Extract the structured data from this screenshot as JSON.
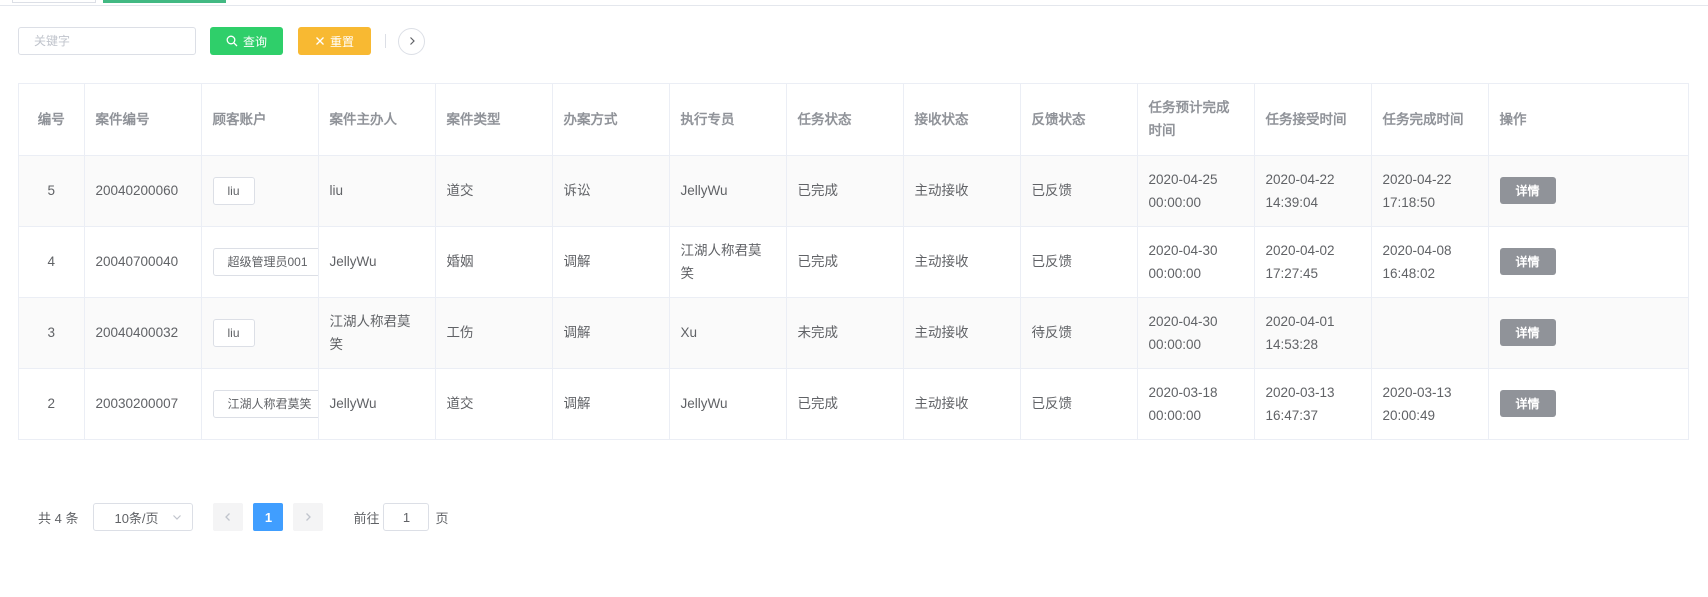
{
  "toolbar": {
    "search_placeholder": "关键字",
    "query_label": "查询",
    "reset_label": "重置"
  },
  "table": {
    "headers": [
      "编号",
      "案件编号",
      "顾客账户",
      "案件主办人",
      "案件类型",
      "办案方式",
      "执行专员",
      "任务状态",
      "接收状态",
      "反馈状态",
      "任务预计完成时间",
      "任务接受时间",
      "任务完成时间",
      "操作"
    ],
    "rows": [
      {
        "id": "5",
        "case_no": "20040200060",
        "account": "liu",
        "host": "liu",
        "type": "道交",
        "method": "诉讼",
        "executor": "JellyWu",
        "task_status": "已完成",
        "receive_status": "主动接收",
        "feedback_status": "已反馈",
        "expected_time": "2020-04-25 00:00:00",
        "accept_time": "2020-04-22 14:39:04",
        "finish_time": "2020-04-22 17:18:50",
        "action": "详情"
      },
      {
        "id": "4",
        "case_no": "20040700040",
        "account": "超级管理员001",
        "host": "JellyWu",
        "type": "婚姻",
        "method": "调解",
        "executor": "江湖人称君莫笑",
        "task_status": "已完成",
        "receive_status": "主动接收",
        "feedback_status": "已反馈",
        "expected_time": "2020-04-30 00:00:00",
        "accept_time": "2020-04-02 17:27:45",
        "finish_time": "2020-04-08 16:48:02",
        "action": "详情"
      },
      {
        "id": "3",
        "case_no": "20040400032",
        "account": "liu",
        "host": "江湖人称君莫笑",
        "type": "工伤",
        "method": "调解",
        "executor": "Xu",
        "task_status": "未完成",
        "receive_status": "主动接收",
        "feedback_status": "待反馈",
        "expected_time": "2020-04-30 00:00:00",
        "accept_time": "2020-04-01 14:53:28",
        "finish_time": "",
        "action": "详情"
      },
      {
        "id": "2",
        "case_no": "20030200007",
        "account": "江湖人称君莫笑",
        "host": "JellyWu",
        "type": "道交",
        "method": "调解",
        "executor": "JellyWu",
        "task_status": "已完成",
        "receive_status": "主动接收",
        "feedback_status": "已反馈",
        "expected_time": "2020-03-18 00:00:00",
        "accept_time": "2020-03-13 16:47:37",
        "finish_time": "2020-03-13 20:00:49",
        "action": "详情"
      }
    ]
  },
  "pagination": {
    "total_label": "共 4 条",
    "page_size_label": "10条/页",
    "current_page": "1",
    "goto_label": "前往",
    "goto_value": "1",
    "page_suffix": "页"
  },
  "colors": {
    "query_button": "#2fcf6a",
    "reset_button": "#f8b932",
    "detail_button": "#909399",
    "active_page": "#409eff",
    "active_tab": "#42b983"
  }
}
